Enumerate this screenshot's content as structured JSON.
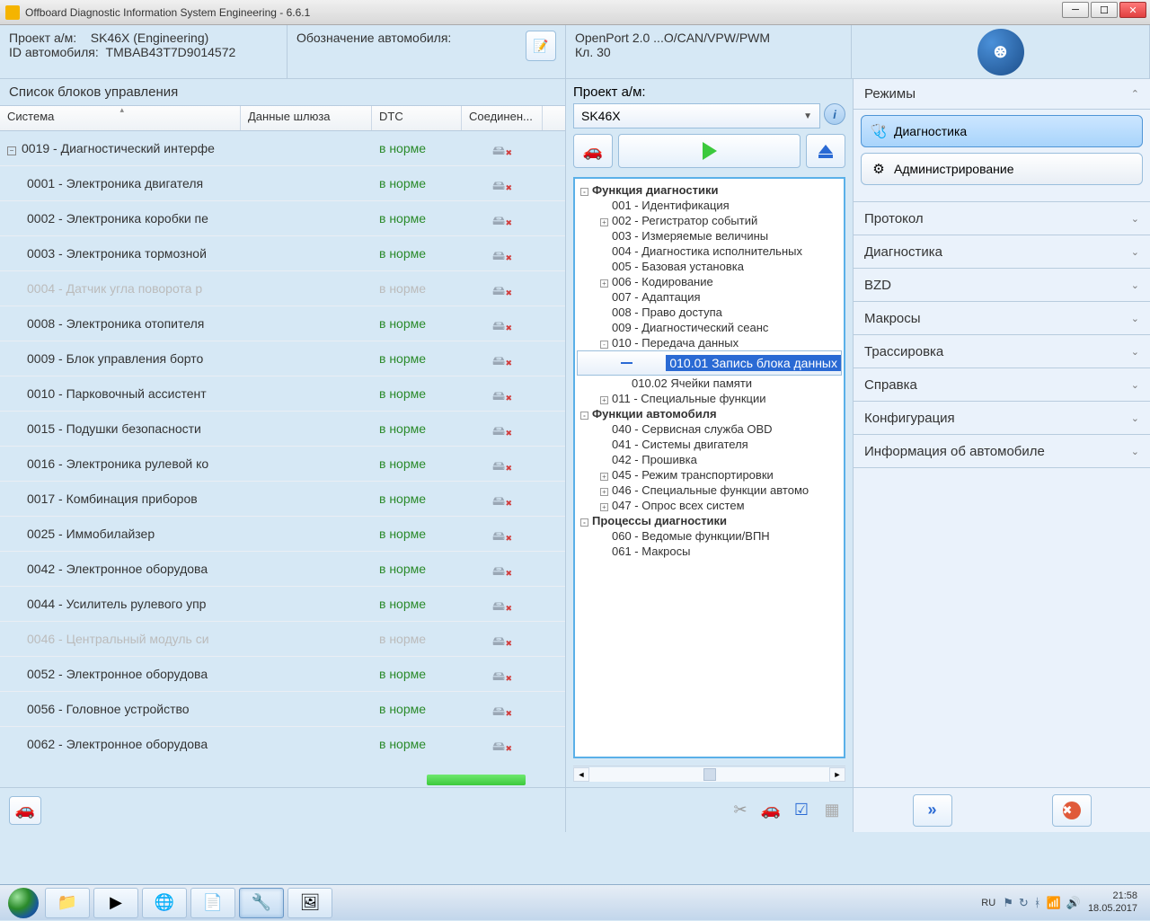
{
  "window": {
    "title": "Offboard Diagnostic Information System Engineering - 6.6.1"
  },
  "header": {
    "project_lbl": "Проект а/м:",
    "project_val": "SK46X    (Engineering)",
    "vehicleid_lbl": "ID автомобиля:",
    "vehicleid_val": "TMBAB43T7D9014572",
    "vehicledesig_lbl": "Обозначение автомобиля:",
    "port_line1": "OpenPort 2.0 ...O/CAN/VPW/PWM",
    "port_line2": "Кл. 30"
  },
  "ecu_list": {
    "title": "Список блоков управления",
    "cols": {
      "c1": "Система",
      "c2": "Данные шлюза",
      "c3": "DTC",
      "c4": "Соединен..."
    },
    "dtc_ok": "в норме",
    "rows": [
      {
        "sys": "0019 - Диагностический интерфе",
        "disabled": false,
        "root": true
      },
      {
        "sys": "0001 - Электроника двигателя",
        "disabled": false
      },
      {
        "sys": "0002 - Электроника коробки пе",
        "disabled": false
      },
      {
        "sys": "0003 - Электроника тормозной",
        "disabled": false
      },
      {
        "sys": "0004 - Датчик угла поворота р",
        "disabled": true
      },
      {
        "sys": "0008 - Электроника отопителя",
        "disabled": false
      },
      {
        "sys": "0009 - Блок управления борто",
        "disabled": false
      },
      {
        "sys": "0010 - Парковочный ассистент",
        "disabled": false
      },
      {
        "sys": "0015 - Подушки безопасности",
        "disabled": false
      },
      {
        "sys": "0016 - Электроника рулевой ко",
        "disabled": false
      },
      {
        "sys": "0017 - Комбинация приборов",
        "disabled": false
      },
      {
        "sys": "0025 - Иммобилайзер",
        "disabled": false
      },
      {
        "sys": "0042 - Электронное оборудова",
        "disabled": false
      },
      {
        "sys": "0044 - Усилитель рулевого упр",
        "disabled": false
      },
      {
        "sys": "0046 - Центральный модуль си",
        "disabled": true
      },
      {
        "sys": "0052 - Электронное оборудова",
        "disabled": false
      },
      {
        "sys": "0056 - Головное устройство",
        "disabled": false
      },
      {
        "sys": "0062 - Электронное оборудова",
        "disabled": false
      }
    ]
  },
  "mid": {
    "project_lbl": "Проект а/м:",
    "project_sel": "SK46X"
  },
  "tree": [
    {
      "lvl": 0,
      "exp": "-",
      "bold": true,
      "txt": "Функция диагностики"
    },
    {
      "lvl": 1,
      "exp": "",
      "txt": "001 - Идентификация"
    },
    {
      "lvl": 1,
      "exp": "+",
      "txt": "002 - Регистратор событий"
    },
    {
      "lvl": 1,
      "exp": "",
      "txt": "003 - Измеряемые величины"
    },
    {
      "lvl": 1,
      "exp": "",
      "txt": "004 - Диагностика исполнительных"
    },
    {
      "lvl": 1,
      "exp": "",
      "txt": "005 - Базовая установка"
    },
    {
      "lvl": 1,
      "exp": "+",
      "txt": "006 - Кодирование"
    },
    {
      "lvl": 1,
      "exp": "",
      "txt": "007 - Адаптация"
    },
    {
      "lvl": 1,
      "exp": "",
      "txt": "008 - Право доступа"
    },
    {
      "lvl": 1,
      "exp": "",
      "txt": "009 - Диагностический сеанс"
    },
    {
      "lvl": 1,
      "exp": "-",
      "txt": "010 - Передача данных"
    },
    {
      "lvl": 2,
      "exp": "",
      "txt": "010.01 Запись блока данных",
      "sel": true
    },
    {
      "lvl": 2,
      "exp": "",
      "txt": "010.02 Ячейки памяти"
    },
    {
      "lvl": 1,
      "exp": "+",
      "txt": "011 - Специальные функции"
    },
    {
      "lvl": 0,
      "exp": "-",
      "bold": true,
      "txt": "Функции автомобиля"
    },
    {
      "lvl": 1,
      "exp": "",
      "txt": "040 - Сервисная служба OBD"
    },
    {
      "lvl": 1,
      "exp": "",
      "txt": "041 - Системы двигателя"
    },
    {
      "lvl": 1,
      "exp": "",
      "txt": "042 - Прошивка"
    },
    {
      "lvl": 1,
      "exp": "+",
      "txt": "045 - Режим транспортировки"
    },
    {
      "lvl": 1,
      "exp": "+",
      "txt": "046 - Специальные функции автомо"
    },
    {
      "lvl": 1,
      "exp": "+",
      "txt": "047 - Опрос всех систем"
    },
    {
      "lvl": 0,
      "exp": "-",
      "bold": true,
      "txt": "Процессы диагностики"
    },
    {
      "lvl": 1,
      "exp": "",
      "txt": "060 - Ведомые функции/ВПН"
    },
    {
      "lvl": 1,
      "exp": "",
      "txt": "061 - Макросы"
    }
  ],
  "modes": {
    "title": "Режимы",
    "diag": "Диагностика",
    "admin": "Администрирование"
  },
  "panels": {
    "p1": "Протокол",
    "p2": "Диагностика",
    "p3": "BZD",
    "p4": "Макросы",
    "p5": "Трассировка",
    "p6": "Справка",
    "p7": "Конфигурация",
    "p8": "Информация об автомобиле"
  },
  "taskbar": {
    "lang": "RU",
    "time": "21:58",
    "date": "18.05.2017"
  }
}
